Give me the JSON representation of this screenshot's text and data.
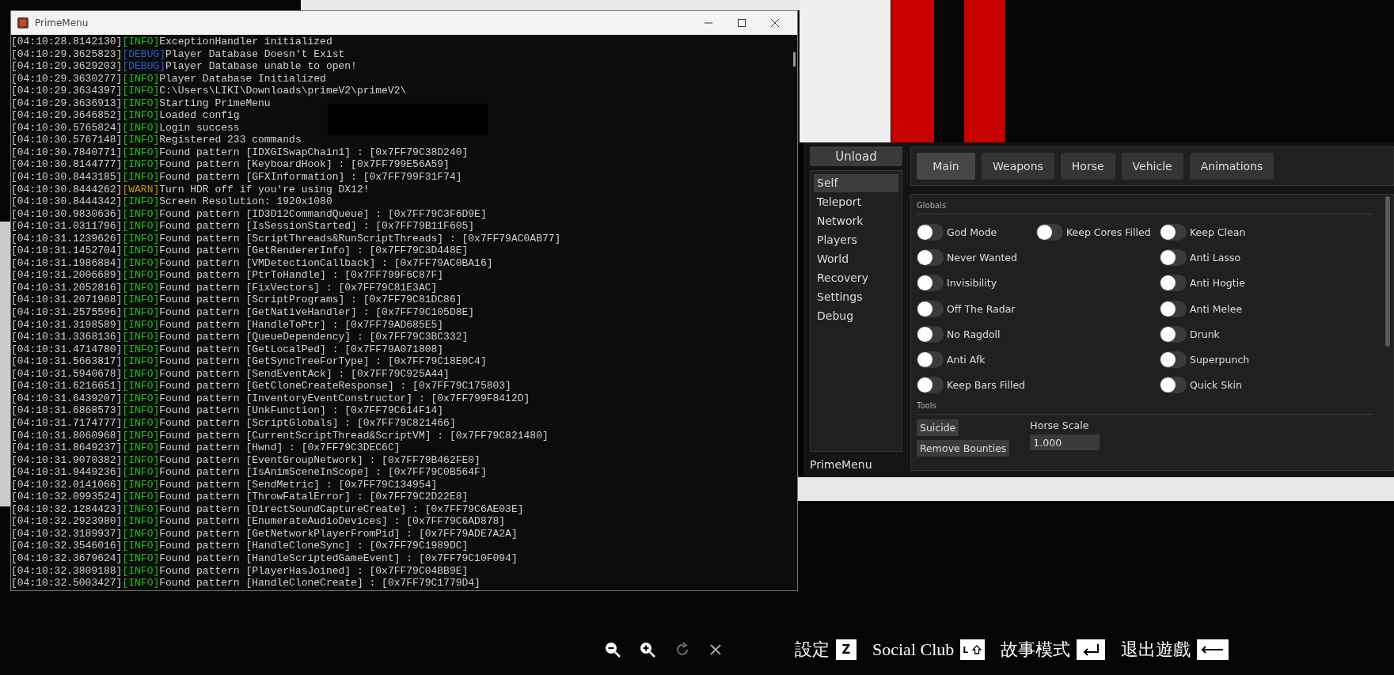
{
  "console_window": {
    "title": "PrimeMenu",
    "lines": [
      {
        "time": "[04:10:28.8142130]",
        "level": "[INFO]",
        "kind": "info",
        "message": "ExceptionHandler initialized"
      },
      {
        "time": "[04:10:29.3625823]",
        "level": "[DEBUG]",
        "kind": "debug",
        "message": "Player Database Doesn't Exist"
      },
      {
        "time": "[04:10:29.3629203]",
        "level": "[DEBUG]",
        "kind": "debug",
        "message": "Player Database unable to open!"
      },
      {
        "time": "[04:10:29.3630277]",
        "level": "[INFO]",
        "kind": "info",
        "message": "Player Database Initialized"
      },
      {
        "time": "[04:10:29.3634397]",
        "level": "[INFO]",
        "kind": "info",
        "message": "C:\\Users\\LIKI\\Downloads\\primeV2\\primeV2\\"
      },
      {
        "time": "[04:10:29.3636913]",
        "level": "[INFO]",
        "kind": "info",
        "message": "Starting PrimeMenu"
      },
      {
        "time": "[04:10:29.3646852]",
        "level": "[INFO]",
        "kind": "info",
        "message": "Loaded config"
      },
      {
        "time": "[04:10:30.5765824]",
        "level": "[INFO]",
        "kind": "info",
        "message": "Login success"
      },
      {
        "time": "[04:10:30.5767148]",
        "level": "[INFO]",
        "kind": "info",
        "message": "Registered 233 commands"
      },
      {
        "time": "[04:10:30.7840771]",
        "level": "[INFO]",
        "kind": "info",
        "message": "Found pattern [IDXGISwapChain1] : [0x7FF79C38D240]"
      },
      {
        "time": "[04:10:30.8144777]",
        "level": "[INFO]",
        "kind": "info",
        "message": "Found pattern [KeyboardHook] : [0x7FF799E56A59]"
      },
      {
        "time": "[04:10:30.8443185]",
        "level": "[INFO]",
        "kind": "info",
        "message": "Found pattern [GFXInformation] : [0x7FF799F31F74]"
      },
      {
        "time": "[04:10:30.8444262]",
        "level": "[WARN]",
        "kind": "warn",
        "message": "Turn HDR off if you're using DX12!"
      },
      {
        "time": "[04:10:30.8444342]",
        "level": "[INFO]",
        "kind": "info",
        "message": "Screen Resolution: 1920x1080"
      },
      {
        "time": "[04:10:30.9830636]",
        "level": "[INFO]",
        "kind": "info",
        "message": "Found pattern [ID3D12CommandQueue] : [0x7FF79C3F6D9E]"
      },
      {
        "time": "[04:10:31.0311796]",
        "level": "[INFO]",
        "kind": "info",
        "message": "Found pattern [IsSessionStarted] : [0x7FF79B11F605]"
      },
      {
        "time": "[04:10:31.1239626]",
        "level": "[INFO]",
        "kind": "info",
        "message": "Found pattern [ScriptThreads&RunScriptThreads] : [0x7FF79AC0AB77]"
      },
      {
        "time": "[04:10:31.1452704]",
        "level": "[INFO]",
        "kind": "info",
        "message": "Found pattern [GetRendererInfo] : [0x7FF79C3D448E]"
      },
      {
        "time": "[04:10:31.1986884]",
        "level": "[INFO]",
        "kind": "info",
        "message": "Found pattern [VMDetectionCallback] : [0x7FF79AC0BA16]"
      },
      {
        "time": "[04:10:31.2006689]",
        "level": "[INFO]",
        "kind": "info",
        "message": "Found pattern [PtrToHandle] : [0x7FF799F6C87F]"
      },
      {
        "time": "[04:10:31.2052816]",
        "level": "[INFO]",
        "kind": "info",
        "message": "Found pattern [FixVectors] : [0x7FF79C81E3AC]"
      },
      {
        "time": "[04:10:31.2071968]",
        "level": "[INFO]",
        "kind": "info",
        "message": "Found pattern [ScriptPrograms] : [0x7FF79C81DC86]"
      },
      {
        "time": "[04:10:31.2575596]",
        "level": "[INFO]",
        "kind": "info",
        "message": "Found pattern [GetNativeHandler] : [0x7FF79C105D8E]"
      },
      {
        "time": "[04:10:31.3198589]",
        "level": "[INFO]",
        "kind": "info",
        "message": "Found pattern [HandleToPtr] : [0x7FF79AD685E5]"
      },
      {
        "time": "[04:10:31.3368136]",
        "level": "[INFO]",
        "kind": "info",
        "message": "Found pattern [QueueDependency] : [0x7FF79C3BC332]"
      },
      {
        "time": "[04:10:31.4714780]",
        "level": "[INFO]",
        "kind": "info",
        "message": "Found pattern [GetLocalPed] : [0x7FF79A071808]"
      },
      {
        "time": "[04:10:31.5663817]",
        "level": "[INFO]",
        "kind": "info",
        "message": "Found pattern [GetSyncTreeForType] : [0x7FF79C18E0C4]"
      },
      {
        "time": "[04:10:31.5940678]",
        "level": "[INFO]",
        "kind": "info",
        "message": "Found pattern [SendEventAck] : [0x7FF79C925A44]"
      },
      {
        "time": "[04:10:31.6216651]",
        "level": "[INFO]",
        "kind": "info",
        "message": "Found pattern [GetCloneCreateResponse] : [0x7FF79C175803]"
      },
      {
        "time": "[04:10:31.6439207]",
        "level": "[INFO]",
        "kind": "info",
        "message": "Found pattern [InventoryEventConstructor] : [0x7FF799F8412D]"
      },
      {
        "time": "[04:10:31.6868573]",
        "level": "[INFO]",
        "kind": "info",
        "message": "Found pattern [UnkFunction] : [0x7FF79C614F14]"
      },
      {
        "time": "[04:10:31.7174777]",
        "level": "[INFO]",
        "kind": "info",
        "message": "Found pattern [ScriptGlobals] : [0x7FF79C821466]"
      },
      {
        "time": "[04:10:31.8060968]",
        "level": "[INFO]",
        "kind": "info",
        "message": "Found pattern [CurrentScriptThread&ScriptVM] : [0x7FF79C821480]"
      },
      {
        "time": "[04:10:31.8649237]",
        "level": "[INFO]",
        "kind": "info",
        "message": "Found pattern [Hwnd] : [0x7FF79C3DEC6C]"
      },
      {
        "time": "[04:10:31.9070382]",
        "level": "[INFO]",
        "kind": "info",
        "message": "Found pattern [EventGroupNetwork] : [0x7FF79B462FE0]"
      },
      {
        "time": "[04:10:31.9449236]",
        "level": "[INFO]",
        "kind": "info",
        "message": "Found pattern [IsAnimSceneInScope] : [0x7FF79C0B564F]"
      },
      {
        "time": "[04:10:32.0141066]",
        "level": "[INFO]",
        "kind": "info",
        "message": "Found pattern [SendMetric] : [0x7FF79C134954]"
      },
      {
        "time": "[04:10:32.0993524]",
        "level": "[INFO]",
        "kind": "info",
        "message": "Found pattern [ThrowFatalError] : [0x7FF79C2D22E8]"
      },
      {
        "time": "[04:10:32.1284423]",
        "level": "[INFO]",
        "kind": "info",
        "message": "Found pattern [DirectSoundCaptureCreate] : [0x7FF79C6AE03E]"
      },
      {
        "time": "[04:10:32.2923980]",
        "level": "[INFO]",
        "kind": "info",
        "message": "Found pattern [EnumerateAudioDevices] : [0x7FF79C6AD878]"
      },
      {
        "time": "[04:10:32.3189937]",
        "level": "[INFO]",
        "kind": "info",
        "message": "Found pattern [GetNetworkPlayerFromPid] : [0x7FF79ADE7A2A]"
      },
      {
        "time": "[04:10:32.3546016]",
        "level": "[INFO]",
        "kind": "info",
        "message": "Found pattern [HandleCloneSync] : [0x7FF79C1989DC]"
      },
      {
        "time": "[04:10:32.3679624]",
        "level": "[INFO]",
        "kind": "info",
        "message": "Found pattern [HandleScriptedGameEvent] : [0x7FF79C10F094]"
      },
      {
        "time": "[04:10:32.3809188]",
        "level": "[INFO]",
        "kind": "info",
        "message": "Found pattern [PlayerHasJoined] : [0x7FF79C04BB9E]"
      },
      {
        "time": "[04:10:32.5003427]",
        "level": "[INFO]",
        "kind": "info",
        "message": "Found pattern [HandleCloneCreate] : [0x7FF79C1779D4]"
      }
    ]
  },
  "menu": {
    "unload_button": "Unload",
    "sidebar": [
      {
        "label": "Self",
        "selected": true
      },
      {
        "label": "Teleport",
        "selected": false
      },
      {
        "label": "Network",
        "selected": false
      },
      {
        "label": "Players",
        "selected": false
      },
      {
        "label": "World",
        "selected": false
      },
      {
        "label": "Recovery",
        "selected": false
      },
      {
        "label": "Settings",
        "selected": false
      },
      {
        "label": "Debug",
        "selected": false
      }
    ],
    "footer": "PrimeMenu",
    "tabs": [
      {
        "label": "Main",
        "selected": true
      },
      {
        "label": "Weapons",
        "selected": false
      },
      {
        "label": "Horse",
        "selected": false
      },
      {
        "label": "Vehicle",
        "selected": false
      },
      {
        "label": "Animations",
        "selected": false
      }
    ],
    "globals": {
      "title": "Globals",
      "columns": [
        [
          {
            "label": "God Mode",
            "on": false
          },
          {
            "label": "Never Wanted",
            "on": false
          },
          {
            "label": "Invisibility",
            "on": false
          },
          {
            "label": "Off The Radar",
            "on": false
          },
          {
            "label": "No Ragdoll",
            "on": false
          },
          {
            "label": "Anti Afk",
            "on": false
          },
          {
            "label": "Keep Bars Filled",
            "on": false
          }
        ],
        [
          {
            "label": "Keep Cores Filled",
            "on": false
          }
        ],
        [
          {
            "label": "Keep Clean",
            "on": false
          },
          {
            "label": "Anti Lasso",
            "on": false
          },
          {
            "label": "Anti Hogtie",
            "on": false
          },
          {
            "label": "Anti Melee",
            "on": false
          },
          {
            "label": "Drunk",
            "on": false
          },
          {
            "label": "Superpunch",
            "on": false
          },
          {
            "label": "Quick Skin",
            "on": false
          }
        ]
      ]
    },
    "tools": {
      "title": "Tools",
      "buttons": [
        "Suicide",
        "Remove Bounties"
      ],
      "horse_scale": {
        "label": "Horse Scale",
        "value": "1.000"
      }
    }
  },
  "key_hints": [
    {
      "label": "設定",
      "key": "Z",
      "kind": "letter"
    },
    {
      "label": "Social Club",
      "key": "L",
      "kind": "shift"
    },
    {
      "label": "故事模式",
      "kind": "enter"
    },
    {
      "label": "退出遊戲",
      "kind": "back"
    }
  ]
}
